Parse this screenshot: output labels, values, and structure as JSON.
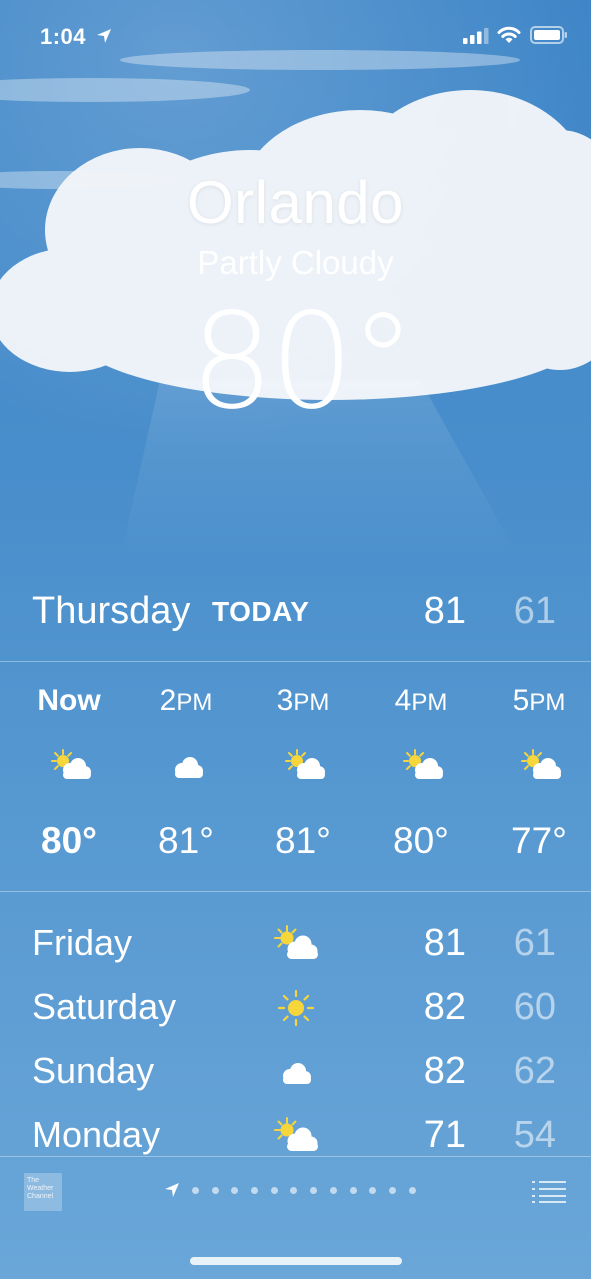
{
  "status_bar": {
    "time": "1:04"
  },
  "location": {
    "city": "Orlando",
    "condition": "Partly Cloudy",
    "temperature": "80°"
  },
  "today": {
    "day": "Thursday",
    "tag": "TODAY",
    "high": "81",
    "low": "61"
  },
  "hourly": [
    {
      "label": "Now",
      "icon": "partly-cloudy-icon",
      "temp": "80°"
    },
    {
      "label": "2PM",
      "icon": "cloud-icon",
      "temp": "81°"
    },
    {
      "label": "3PM",
      "icon": "partly-cloudy-icon",
      "temp": "81°"
    },
    {
      "label": "4PM",
      "icon": "partly-cloudy-icon",
      "temp": "80°"
    },
    {
      "label": "5PM",
      "icon": "partly-cloudy-icon",
      "temp": "77°"
    }
  ],
  "daily": [
    {
      "day": "Friday",
      "icon": "partly-cloudy-icon",
      "high": "81",
      "low": "61"
    },
    {
      "day": "Saturday",
      "icon": "sun-icon",
      "high": "82",
      "low": "60"
    },
    {
      "day": "Sunday",
      "icon": "cloud-icon",
      "high": "82",
      "low": "62"
    },
    {
      "day": "Monday",
      "icon": "partly-cloudy-icon",
      "high": "71",
      "low": "54"
    }
  ],
  "footer": {
    "logo_text": "The Weather Channel",
    "page_count": 13,
    "current_page": 0
  },
  "colors": {
    "sky_top": "#3f86c8",
    "sky_bottom": "#6aa6d8",
    "sun": "#f6d63b",
    "low_temp": "rgba(255,255,255,0.55)"
  }
}
